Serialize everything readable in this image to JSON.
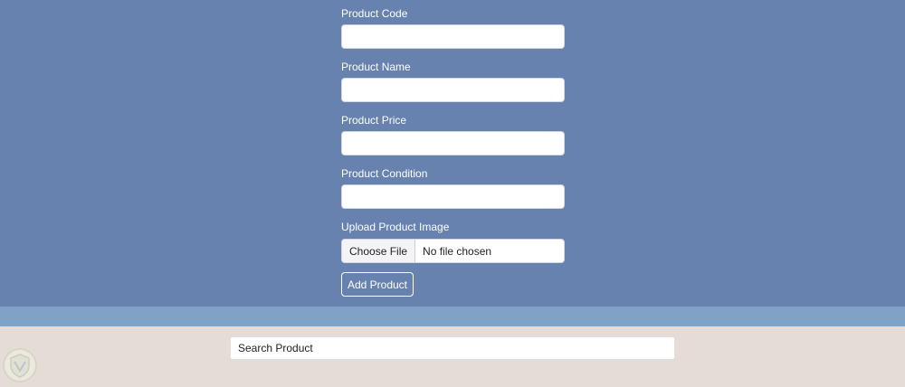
{
  "form": {
    "code_label": "Product Code",
    "name_label": "Product Name",
    "price_label": "Product Price",
    "condition_label": "Product Condition",
    "image_label": "Upload Product Image",
    "choose_file_label": "Choose File",
    "file_status": "No file chosen",
    "submit_label": "Add Product"
  },
  "search": {
    "placeholder": "Search Product"
  },
  "colors": {
    "form_background": "#6782ae",
    "divider": "#7fa2c6",
    "search_background": "#e5dcd8"
  },
  "icons": {
    "logo": "shield-logo-icon"
  }
}
